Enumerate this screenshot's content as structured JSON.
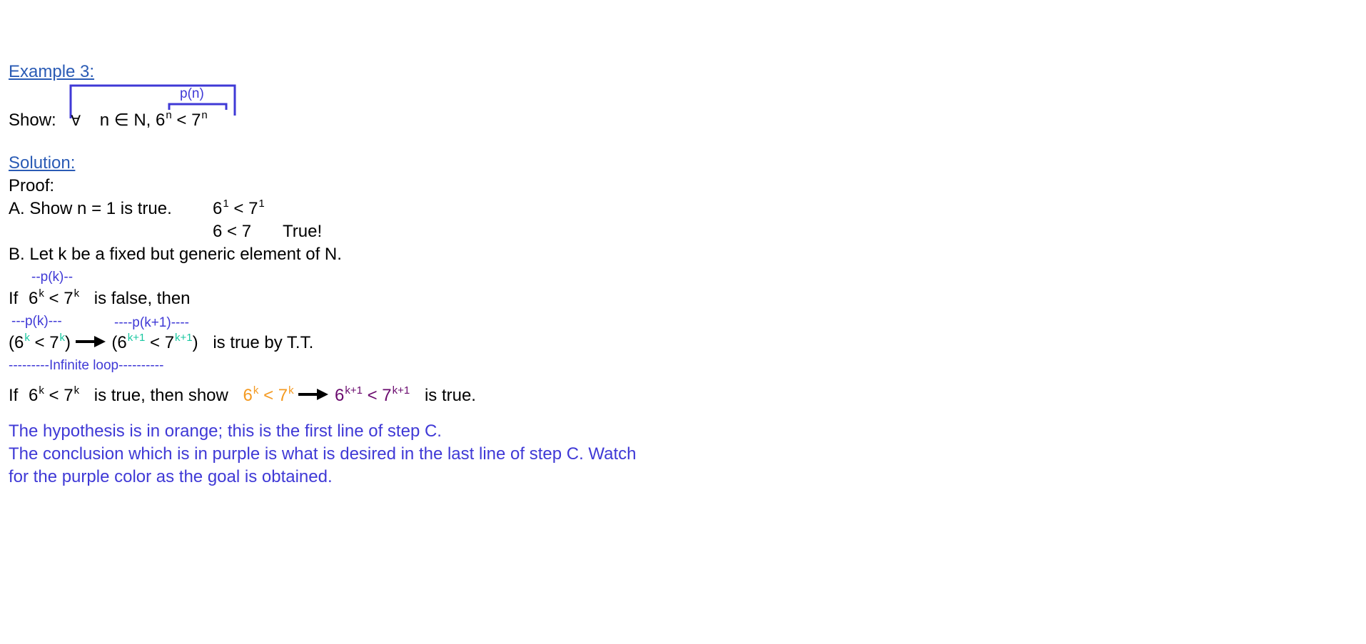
{
  "example_title": "Example 3:",
  "show": {
    "label": "Show:",
    "forall": "∀",
    "n_in_N": "n ∈ N,",
    "six": "6",
    "exp_n": "n",
    "lt": "<",
    "seven": "7",
    "exp_n2": "n",
    "bracket_label": "p(n)"
  },
  "solution_title": "Solution:",
  "proof_label": "Proof:",
  "step_a": {
    "text": "A.  Show n = 1 is true.",
    "ineq_six": "6",
    "ineq_exp1": "1",
    "ineq_lt": "<",
    "ineq_seven": "7",
    "ineq_exp2": "1",
    "line2": "6 < 7",
    "line2_result": "True!"
  },
  "step_b": {
    "text": "B.  Let k be a fixed but generic element of N."
  },
  "pk_label_1": "--p(k)--",
  "if_false": {
    "if": "If",
    "six": "6",
    "exp_k": "k",
    "lt": "<",
    "seven": "7",
    "exp_k2": "k",
    "rest": "is false,  then"
  },
  "pk_label_2": "---p(k)---",
  "pk1_label": "----p(k+1)----",
  "implication": {
    "open": "(6",
    "exp_k": "k",
    "mid": " < 7",
    "exp_k2": "k",
    "close": ")",
    "open2": "(6",
    "exp_k1": "k+1",
    "mid2": " < 7",
    "exp_k1b": "k+1",
    "close2": ")",
    "rest": "is true by T.T."
  },
  "infinite_loop": "---------Infinite loop----------",
  "if_true": {
    "if": "If",
    "six": "6",
    "exp_k": "k",
    "lt": "<",
    "seven": "7",
    "exp_k2": "k",
    "mid": "is true,  then show",
    "hyp_six": "6",
    "hyp_exp": "k",
    "hyp_lt": "<",
    "hyp_seven": "7",
    "hyp_exp2": "k",
    "con_six": "6",
    "con_exp": "k+1",
    "con_lt": "<",
    "con_seven": "7",
    "con_exp2": "k+1",
    "end": "is true."
  },
  "note_line1": "The hypothesis is in orange; this is the first line of step C.",
  "note_line2": "The conclusion which is in purple is what is desired in the last line of step C.  Watch",
  "note_line3": "for the purple color as the goal is obtained.",
  "colors": {
    "link": "#2a5bb5",
    "annotation_blue": "#3f39d6",
    "orange": "#f49a21",
    "purple": "#6a0a6e",
    "teal": "#19c7a0"
  },
  "icons": [
    "right-arrow-icon",
    "bracket-shape"
  ]
}
